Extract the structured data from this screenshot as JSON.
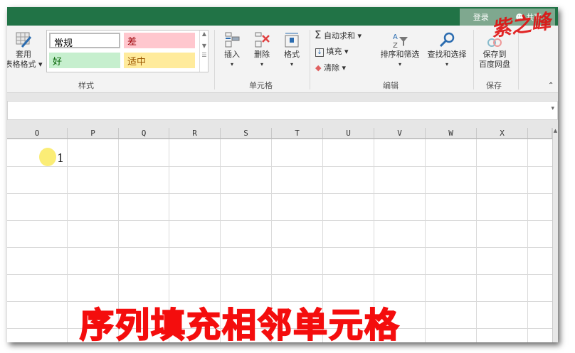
{
  "titlebar": {
    "login": "登录",
    "share": "共享",
    "watermark": "紫之峰"
  },
  "ribbon": {
    "format_table": {
      "line1": "套用",
      "line2": "表格格式"
    },
    "styles": {
      "normal": "常规",
      "bad": "差",
      "good": "好",
      "neutral": "适中",
      "group": "样式"
    },
    "cells": {
      "insert": "插入",
      "delete": "删除",
      "format": "格式",
      "group": "单元格"
    },
    "editing": {
      "autosum": "自动求和",
      "fill": "填充",
      "clear": "清除",
      "sort": "排序和筛选",
      "find": "查找和选择",
      "group": "编辑"
    },
    "save": {
      "line1": "保存到",
      "line2": "百度网盘",
      "group": "保存"
    }
  },
  "grid": {
    "columns": [
      "O",
      "P",
      "Q",
      "R",
      "S",
      "T",
      "U",
      "V",
      "W",
      "X"
    ],
    "cell_value": "1"
  },
  "caption": "序列填充相邻单元格",
  "colors": {
    "title": "#217346",
    "caption": "#f40d0d"
  }
}
